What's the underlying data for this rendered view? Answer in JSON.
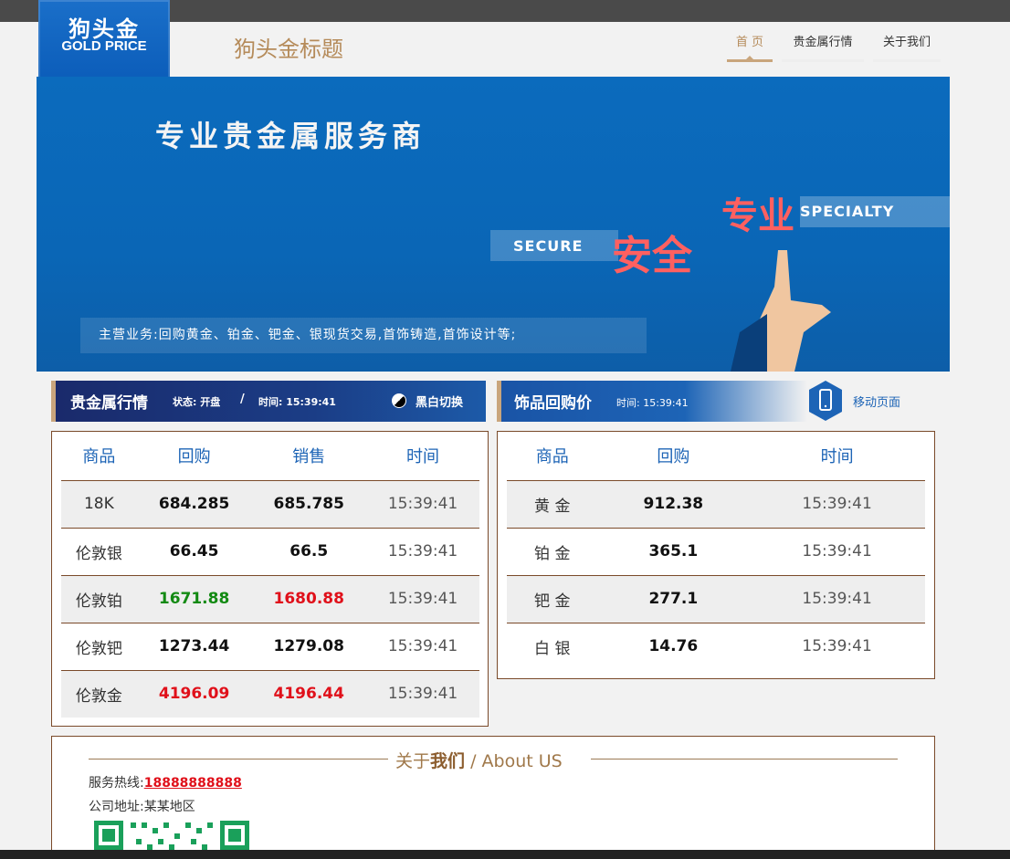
{
  "logo": {
    "cn": "狗头金",
    "en": "GOLD PRICE"
  },
  "site_title": "狗头金标题",
  "nav": [
    {
      "label": "首 页"
    },
    {
      "label": "贵金属行情"
    },
    {
      "label": "关于我们"
    }
  ],
  "banner": {
    "headline": "专业贵金属服务商",
    "specialty_en": "SPECIALTY",
    "specialty_cn": "专业",
    "secure_en": "SECURE",
    "secure_cn": "安全",
    "business": "主营业务:回购黄金、铂金、钯金、银现货交易,首饰铸造,首饰设计等;"
  },
  "metals_bar": {
    "title": "贵金属行情",
    "status": "状态: 开盘",
    "slash": "/",
    "time": "时间: 15:39:41",
    "toggle": "黑白切换"
  },
  "jewelry_bar": {
    "title": "饰品回购价",
    "time": "时间: 15:39:41",
    "mobile_link": "移动页面"
  },
  "metals_table": {
    "headers": [
      "商品",
      "回购",
      "销售",
      "时间"
    ],
    "rows": [
      {
        "name": "18K",
        "buy": "684.285",
        "sell": "685.785",
        "time": "15:39:41"
      },
      {
        "name": "伦敦银",
        "buy": "66.45",
        "sell": "66.5",
        "time": "15:39:41"
      },
      {
        "name": "伦敦铂",
        "buy": "1671.88",
        "sell": "1680.88",
        "time": "15:39:41"
      },
      {
        "name": "伦敦钯",
        "buy": "1273.44",
        "sell": "1279.08",
        "time": "15:39:41"
      },
      {
        "name": "伦敦金",
        "buy": "4196.09",
        "sell": "4196.44",
        "time": "15:39:41"
      }
    ]
  },
  "jewelry_table": {
    "headers": [
      "商品",
      "回购",
      "时间"
    ],
    "rows": [
      {
        "name": "黄 金",
        "buy": "912.38",
        "time": "15:39:41"
      },
      {
        "name": "铂 金",
        "buy": "365.1",
        "time": "15:39:41"
      },
      {
        "name": "钯 金",
        "buy": "277.1",
        "time": "15:39:41"
      },
      {
        "name": "白 银",
        "buy": "14.76",
        "time": "15:39:41"
      }
    ]
  },
  "about": {
    "title_cn_a": "关于",
    "title_cn_b": "我们",
    "title_en": " / About US",
    "hotline_label": "服务热线:",
    "hotline": "18888888888",
    "address_label": "公司地址:",
    "address": "某某地区"
  },
  "colors": {
    "brand_blue": "#0b6bbd",
    "gold": "#c9a57c",
    "up_red": "#e0101a",
    "down_green": "#138a13"
  }
}
